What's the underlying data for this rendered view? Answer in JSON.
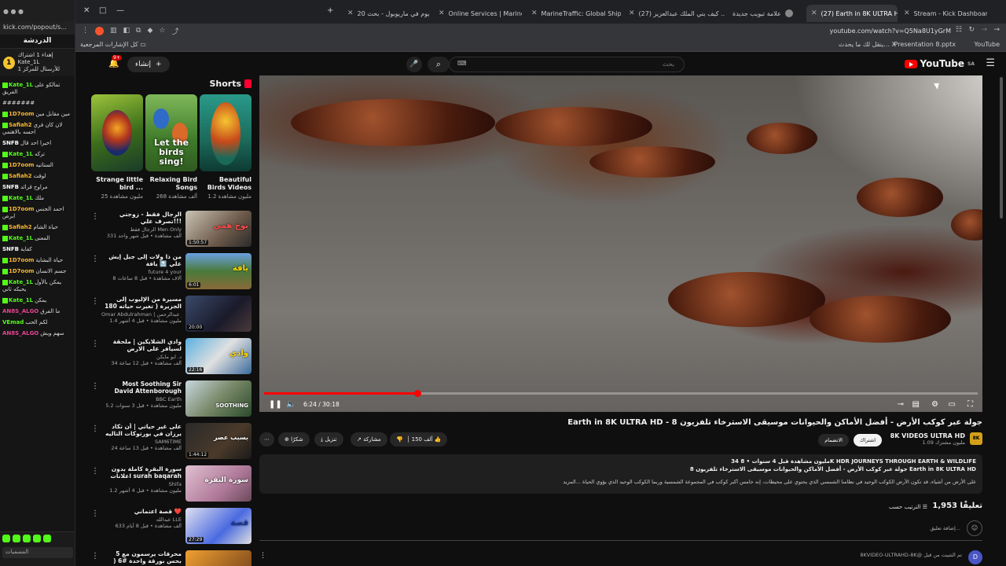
{
  "kick": {
    "url": "kick.com/popout/s...",
    "header": "الدردشة",
    "pinned_text": "إهداء 1 اشتراك Kate_1L",
    "pinned_sub": "للأرسنال للمركز 1",
    "messages": [
      {
        "user": "Kate_1L",
        "text": "تمالكو على الفريق"
      },
      {
        "user": "",
        "text": "#######"
      },
      {
        "user": "1D7oom",
        "text": "مين مقابل مين"
      },
      {
        "user": "Safiah2",
        "text": "لان كان فري احسه بالاهتمي"
      },
      {
        "user": "SNFB",
        "text": "اخيرا احد قال"
      },
      {
        "user": "Kate_1L",
        "text": "تركه"
      },
      {
        "user": "1D7oom",
        "text": "الستاتيه"
      },
      {
        "user": "Safiah2",
        "text": "لوقت"
      },
      {
        "user": "SNFB",
        "text": "مراوح قرائد"
      },
      {
        "user": "Kate_1L",
        "text": "ملك"
      },
      {
        "user": "1D7oom",
        "text": "احمد الجنس ابرص"
      },
      {
        "user": "Safiah2",
        "text": "حياة الشام"
      },
      {
        "user": "Kate_1L",
        "text": "المعنى"
      },
      {
        "user": "SNFB",
        "text": "كفاية"
      },
      {
        "user": "1D7oom",
        "text": "حياة البشاية"
      },
      {
        "user": "1D7oom",
        "text": "جسم الانسان"
      },
      {
        "user": "Kate_1L",
        "text": "يمكن بالأول يحبكه ثاني"
      },
      {
        "user": "Kate_1L",
        "text": "يمكن"
      },
      {
        "user": "AN8S_ALGO",
        "text": "ما الفرق"
      },
      {
        "user": "VEmad",
        "text": "لكم الحب"
      },
      {
        "user": "AN8S_ALGO",
        "text": "سهم ويش"
      }
    ],
    "input_placeholder": "المسميات"
  },
  "browser": {
    "tabs": [
      {
        "label": "Stream - Kick Dashboard",
        "color": "#53fc18",
        "active": false
      },
      {
        "label": "(27) Earth in 8K ULTRA HD",
        "color": "#ff0000",
        "active": true
      },
      {
        "label": "علامة تبويب جديدة",
        "color": "#888888",
        "active": false
      },
      {
        "label": "(27) كيف بني الملك عبدالعزيز ...",
        "color": "#ff0000",
        "active": false
      },
      {
        "label": "MarineTraffic: Global Ship Track",
        "color": "#1565c0",
        "active": false
      },
      {
        "label": "Online Services | MarineTraffic",
        "color": "#1565c0",
        "active": false
      },
      {
        "label": "20 يوم في ماريوبول - بحث Google",
        "color": "#dddddd",
        "active": false
      }
    ],
    "url": "youtube.com/watch?v=Q5Na8U1yGrM",
    "bookmarks": {
      "left": "YouTube",
      "presentation": "Presentation 8.pptx",
      "news": "ينقل لك ما يحدث...",
      "all": "كل الإشارات المرجعية"
    }
  },
  "youtube": {
    "logo": "YouTube",
    "logo_region": "SA",
    "search_placeholder": "بحث",
    "create_label": "إنشاء",
    "notif_count": "9+",
    "shorts_label": "Shorts",
    "shorts": [
      {
        "title": "Beautiful Birds Videos",
        "views": "1.2 مليون مشاهدة",
        "overlay": ""
      },
      {
        "title": "Relaxing Bird Songs",
        "views": "268 ألف مشاهدة",
        "overlay": "Let the birds sing!"
      },
      {
        "title": "Strange little bird ...",
        "views": "25 مليون مشاهدة",
        "overlay": ""
      }
    ],
    "recommendations": [
      {
        "title": "الرجال فقط - زوجتي تصرف علي!!!",
        "channel": "الرجال فقط Men Only",
        "views": "331 ألف مشاهدة • قبل شهر واحد",
        "duration": "1:50:57",
        "thumb_text": "بوح همي"
      },
      {
        "title": "من ذا ولات إلى جبل إيش علي 🔝 يافة",
        "channel": "future 4 your",
        "views": "8 آلاف مشاهدة • قبل 8 ساعات",
        "duration": "6:01",
        "thumb_text": "يافة"
      },
      {
        "title": "مسيرة من الإليوب إلى الجزيرة ( تغيرت حياته 180 درجة)",
        "channel": "Omar Abdulrahman | عمر عبدالرحمن",
        "views": "1.4 مليون مشاهدة • قبل 4 أشهر",
        "duration": "20:00",
        "thumb_text": ""
      },
      {
        "title": "وادي الشلايكين | ملحقة لسيافر على الارض",
        "channel": "د. ابو مايكن",
        "views": "34 ألف مشاهدة • قبل 12 ساعة",
        "duration": "22:16",
        "thumb_text": "وادي"
      },
      {
        "title": "Most Soothing Sir David Attenborough Moments | BBC Earth",
        "channel": "BBC Earth",
        "views": "5.2 مليون مشاهدة • قبل 3 سنوات",
        "duration": "",
        "thumb_text": "SOOTHING"
      },
      {
        "title": "على غير حياتي | أن تكاد يرزان في بورتوكات التاليه",
        "channel": "SAM6TIME",
        "views": "24 ألف مشاهدة • قبل 13 ساعة",
        "duration": "1:44:12",
        "thumb_text": "بسبب عصر"
      },
      {
        "title": "سورة البقرة كاملة بدون اعلانات surah baqarah saud",
        "channel": "Shifa",
        "views": "1.2 مليون مشاهدة • قبل 4 أشهر",
        "duration": "",
        "thumb_text": "سورة البقرة"
      },
      {
        "title": "قصة اعتماني ❤️",
        "channel": "عبدالله LLE",
        "views": "633 ألف مشاهدة • قبل 8 أيام",
        "duration": "27:29",
        "thumb_text": "قصة"
      },
      {
        "title": "5 محرقات يرسمون مع بحس بورقة واحدة #6 ( قليل بالحياة الرقمية",
        "channel": "",
        "views": "",
        "duration": "",
        "thumb_text": ""
      }
    ],
    "player": {
      "time": "6:24 / 30:18",
      "progress_percent": 21.5
    },
    "video_title": "Earth in 8K ULTRA HD - 8 جولة عبر كوكب الأرض - أفضل الأماكن والحيوانات موسيقى الاسترخاء تلفزيون",
    "channel": {
      "name": "8K VIDEOS ULTRA HD",
      "subs": "1.09 مليون مشترك",
      "avatar": "8K"
    },
    "actions": {
      "likes": "150 ألف",
      "share": "مشاركة",
      "download": "تنزيل",
      "thanks": "شكرًا",
      "join": "الانضمام",
      "subscribe": "اشتراك"
    },
    "description": {
      "line1": "34 مليون مشاهدة قبل 4 سنوات • 8K HDR JOURNEYS THROUGH EARTH & WILDLIFE",
      "line2": "8 جولة عبر كوكب الأرض - أفضل الأماكن والحيوانات موسيقى الاسترخاء تلفزيون Earth in 8K ULTRA HD",
      "line3": "على الأرض من أشياء، قد تكون الأرض الكوكب الوحيد في نظامنا الشمسي الذي يحتوي على محيطات، إنه خامس أكبر كوكب في المجموعة الشمسية وربما الكوكب الوحيد الذي يؤوي الحياة ...المزيد"
    },
    "comments": {
      "count": "1,953 تعليقًا",
      "sort": "الترتيب حسب",
      "add_placeholder": "إضافة تعليق...",
      "first": "8KVIDEO-ULTRAHD-8K@ تم التثبيت من قبل"
    }
  }
}
